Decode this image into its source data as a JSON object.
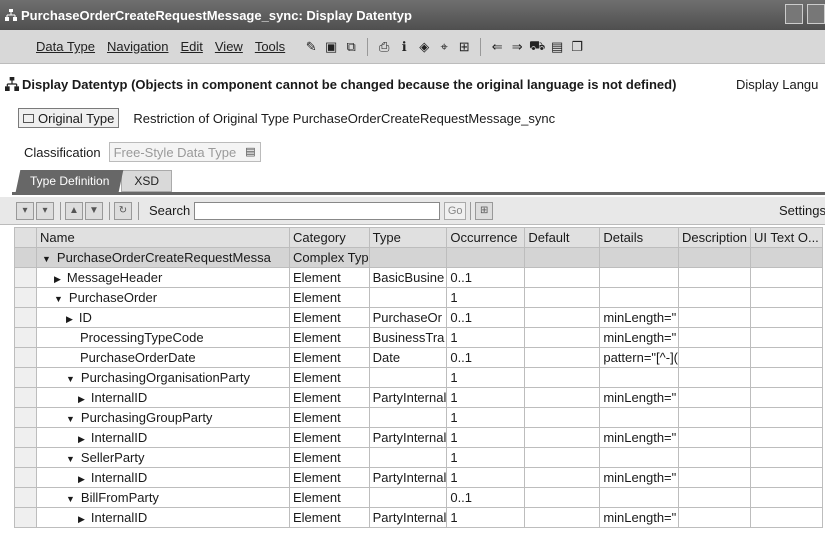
{
  "window": {
    "title": "PurchaseOrderCreateRequestMessage_sync: Display Datentyp"
  },
  "menubar": {
    "items": [
      "Data Type",
      "Navigation",
      "Edit",
      "View",
      "Tools"
    ]
  },
  "header": {
    "title": "Display Datentyp (Objects in component cannot be changed because the original language is not defined)",
    "display_language": "Display Langu"
  },
  "original_type_button": "Original Type",
  "restriction_text": "Restriction of Original Type PurchaseOrderCreateRequestMessage_sync",
  "classification": {
    "label": "Classification",
    "value": "Free-Style Data Type"
  },
  "tabs": [
    "Type Definition",
    "XSD"
  ],
  "toolbar": {
    "search_label": "Search",
    "search_value": "",
    "go": "Go",
    "settings": "Settings"
  },
  "table": {
    "columns": [
      "Name",
      "Category",
      "Type",
      "Occurrence",
      "Default",
      "Details",
      "Description",
      "UI Text O..."
    ],
    "rows": [
      {
        "indent": 0,
        "toggle": "open",
        "name": "PurchaseOrderCreateRequestMessa",
        "category": "Complex Typ",
        "type": "",
        "occurrence": "",
        "default": "",
        "details": "",
        "description": "",
        "ui_text": "",
        "grey": true
      },
      {
        "indent": 1,
        "toggle": "closed",
        "name": "MessageHeader",
        "category": "Element",
        "type": "BasicBusine",
        "occurrence": "0..1",
        "default": "",
        "details": "",
        "description": "",
        "ui_text": ""
      },
      {
        "indent": 1,
        "toggle": "open",
        "name": "PurchaseOrder",
        "category": "Element",
        "type": "",
        "occurrence": "1",
        "default": "",
        "details": "",
        "description": "",
        "ui_text": ""
      },
      {
        "indent": 2,
        "toggle": "closed",
        "name": "ID",
        "category": "Element",
        "type": "PurchaseOr",
        "occurrence": "0..1",
        "default": "",
        "details": "minLength=\"",
        "description": "",
        "ui_text": ""
      },
      {
        "indent": 2,
        "toggle": "none",
        "name": "ProcessingTypeCode",
        "category": "Element",
        "type": "BusinessTra",
        "occurrence": "1",
        "default": "",
        "details": "minLength=\"",
        "description": "",
        "ui_text": ""
      },
      {
        "indent": 2,
        "toggle": "none",
        "name": "PurchaseOrderDate",
        "category": "Element",
        "type": "Date",
        "occurrence": "0..1",
        "default": "",
        "details": "pattern=\"[^-](",
        "description": "",
        "ui_text": ""
      },
      {
        "indent": 2,
        "toggle": "open",
        "name": "PurchasingOrganisationParty",
        "category": "Element",
        "type": "",
        "occurrence": "1",
        "default": "",
        "details": "",
        "description": "",
        "ui_text": ""
      },
      {
        "indent": 3,
        "toggle": "closed",
        "name": "InternalID",
        "category": "Element",
        "type": "PartyInternal",
        "occurrence": "1",
        "default": "",
        "details": "minLength=\"",
        "description": "",
        "ui_text": ""
      },
      {
        "indent": 2,
        "toggle": "open",
        "name": "PurchasingGroupParty",
        "category": "Element",
        "type": "",
        "occurrence": "1",
        "default": "",
        "details": "",
        "description": "",
        "ui_text": ""
      },
      {
        "indent": 3,
        "toggle": "closed",
        "name": "InternalID",
        "category": "Element",
        "type": "PartyInternal",
        "occurrence": "1",
        "default": "",
        "details": "minLength=\"",
        "description": "",
        "ui_text": ""
      },
      {
        "indent": 2,
        "toggle": "open",
        "name": "SellerParty",
        "category": "Element",
        "type": "",
        "occurrence": "1",
        "default": "",
        "details": "",
        "description": "",
        "ui_text": ""
      },
      {
        "indent": 3,
        "toggle": "closed",
        "name": "InternalID",
        "category": "Element",
        "type": "PartyInternal",
        "occurrence": "1",
        "default": "",
        "details": "minLength=\"",
        "description": "",
        "ui_text": ""
      },
      {
        "indent": 2,
        "toggle": "open",
        "name": "BillFromParty",
        "category": "Element",
        "type": "",
        "occurrence": "0..1",
        "default": "",
        "details": "",
        "description": "",
        "ui_text": ""
      },
      {
        "indent": 3,
        "toggle": "closed",
        "name": "InternalID",
        "category": "Element",
        "type": "PartyInternal",
        "occurrence": "1",
        "default": "",
        "details": "minLength=\"",
        "description": "",
        "ui_text": ""
      }
    ]
  }
}
